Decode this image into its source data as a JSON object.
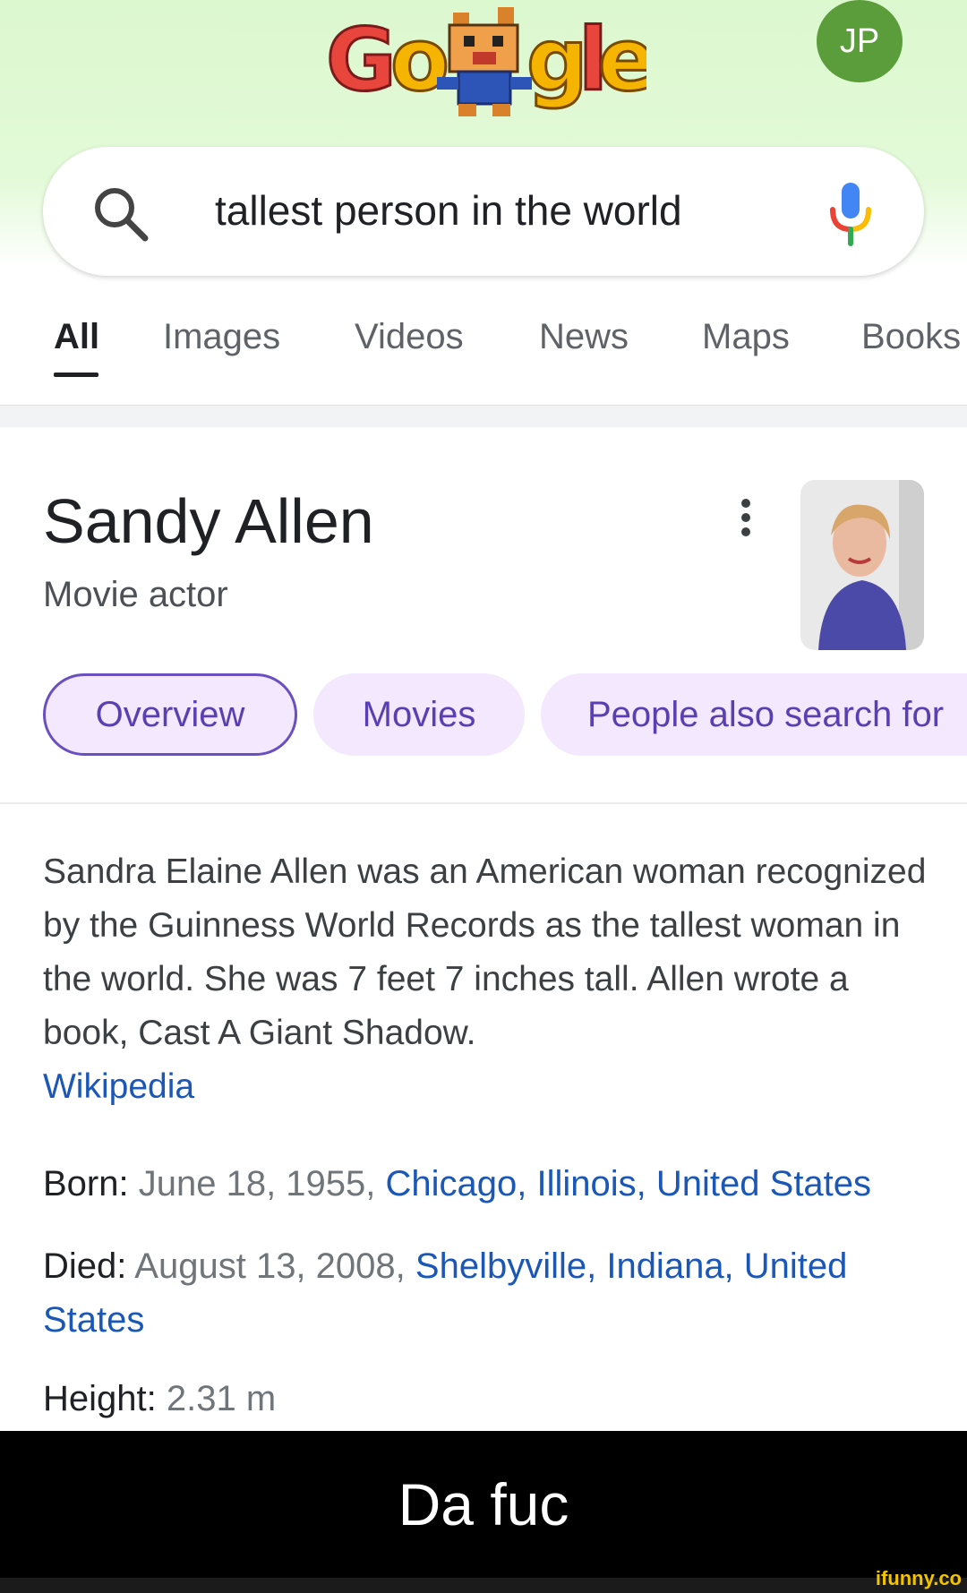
{
  "logo": {
    "text": "Google",
    "style": "pixel-art doodle",
    "icon": "google-doodle-logo"
  },
  "account": {
    "initials": "JP",
    "color": "#5a9d3a"
  },
  "search": {
    "query": "tallest person in the world"
  },
  "tabs": [
    {
      "label": "All",
      "active": true
    },
    {
      "label": "Images"
    },
    {
      "label": "Videos"
    },
    {
      "label": "News"
    },
    {
      "label": "Maps"
    },
    {
      "label": "Books"
    }
  ],
  "entity": {
    "name": "Sandy Allen",
    "type": "Movie actor",
    "chips": [
      "Overview",
      "Movies",
      "People also search for"
    ],
    "description": "Sandra Elaine Allen was an American woman recognized by the Guinness World Records as the tallest woman in the world. She was 7 feet 7 inches tall. Allen wrote a book, Cast A Giant Shadow.",
    "source": "Wikipedia",
    "facts": {
      "born": {
        "label": "Born:",
        "value": "June 18, 1955,",
        "link": "Chicago, Illinois, United States"
      },
      "died": {
        "label": "Died:",
        "value": "August 13, 2008,",
        "link": "Shelbyville, Indiana, United States"
      },
      "height": {
        "label": "Height:",
        "value": "2.31 m"
      }
    }
  },
  "caption": "Da fuc",
  "watermark": "ifunny.co",
  "colors": {
    "accent": "#5b3fb2",
    "link": "#1a57b7",
    "header_bg": "#dcf8cf"
  }
}
